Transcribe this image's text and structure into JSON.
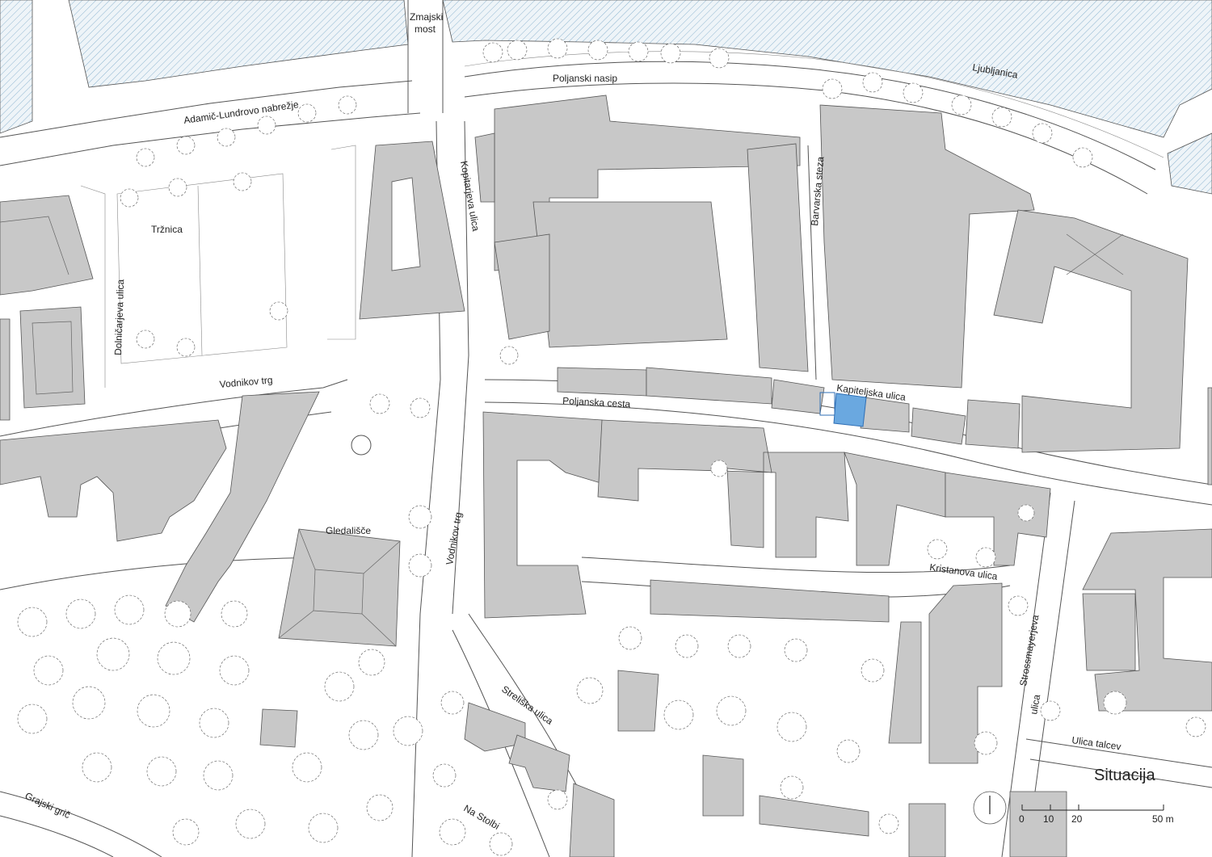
{
  "map": {
    "title": "Situacija",
    "labels": {
      "zmajski": "Zmajski",
      "most": "most",
      "poljanski_nasip": "Poljanski nasip",
      "ljubljanica": "Ljubljanica",
      "adamic": "Adamič-Lundrovo nabrežje",
      "trznica": "Tržnica",
      "dolnicarjeva": "Dolničarjeva ulica",
      "kopitarjeva": "Kopitarjeva ulica",
      "barvarska": "Barvarska steza",
      "vodnikov_trg_1": "Vodnikov trg",
      "vodnikov_trg_2": "Vodnikov trg",
      "kapiteljska": "Kapiteljska ulica",
      "poljanska": "Poljanska cesta",
      "gledalisce": "Gledališče",
      "kristanova": "Kristanova ulica",
      "strossmayerjeva": "Strossmayerjeva",
      "ulica": "ulica",
      "streliska": "Streliška ulica",
      "ulica_talcev": "Ulica talcev",
      "na_stolbi": "Na Stolbi",
      "grajski_gric": "Grajski grič"
    },
    "scale": {
      "ticks": [
        "0",
        "10",
        "20",
        "50 m"
      ]
    },
    "colors": {
      "building": "#c8c8c8",
      "highlight": "#6aa8e0",
      "water_hatch": "#8fb6d1"
    }
  }
}
